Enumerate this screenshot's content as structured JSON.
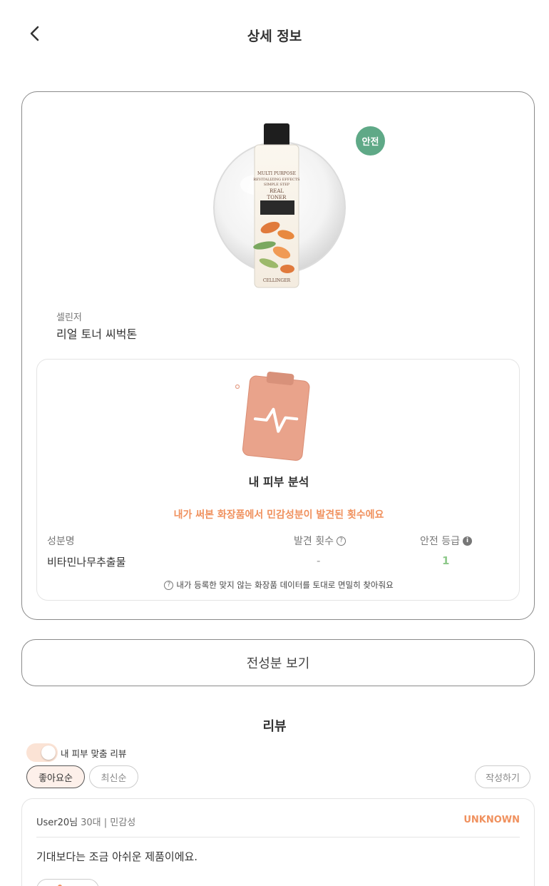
{
  "header": {
    "title": "상세 정보"
  },
  "product": {
    "badge": "안전",
    "brand": "셀린저",
    "name": "리얼 토너 씨벅톤",
    "bottle_label": {
      "line1": "MULTI PURPOSE",
      "line2": "REVITALIZING EFFECTS",
      "line3": "SIMPLE STEP",
      "title1": "REAL",
      "title2": "TONER",
      "brand": "CELLINGER"
    }
  },
  "analysis": {
    "title": "내 피부 분석",
    "subtitle": "내가 써본 화장품에서 민감성분이 발견된 횟수에요",
    "columns": {
      "name": "성분명",
      "count": "발견 횟수",
      "grade": "안전 등급"
    },
    "rows": [
      {
        "name": "비타민나무추출물",
        "count": "-",
        "grade": "1"
      }
    ],
    "note": "내가 등록한 맞지 않는 화장품 데이터를 토대로 면밀히 찾아줘요"
  },
  "ingredients_button": "전성분 보기",
  "reviews": {
    "title": "리뷰",
    "toggle_label": "내 피부 맞춤 리뷰",
    "toggle_on": false,
    "sort": {
      "like": "좋아요순",
      "recent": "최신순"
    },
    "write": "작성하기",
    "items": [
      {
        "user": "User20님",
        "meta": "30대 | 민감성",
        "skin_type": "UNKNOWN",
        "text": "기대보다는 조금 아쉬운 제품이에요."
      }
    ]
  },
  "colors": {
    "accent": "#f0915e",
    "safe": "#5fa987",
    "grade_good": "#8ec98b",
    "clipboard": "#e8a08a"
  }
}
